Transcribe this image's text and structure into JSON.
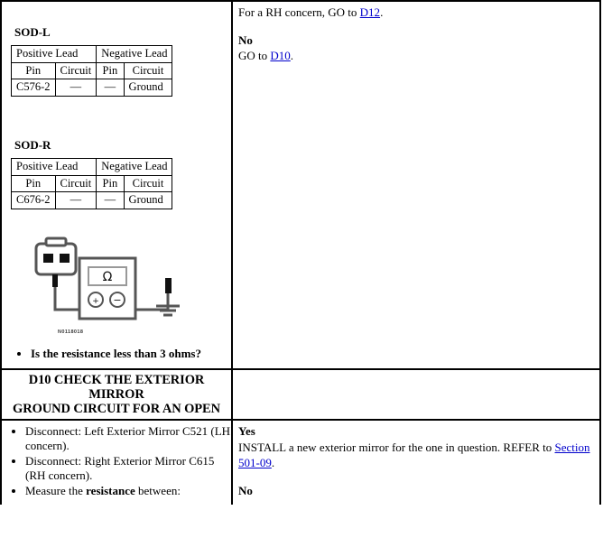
{
  "document": {
    "type": "diagnostic-pinpoint-test",
    "figure_id": "N0118018"
  },
  "row_continued": {
    "left": {
      "tables": [
        {
          "title": "SOD-L",
          "header_row_1": [
            "Positive Lead",
            "Negative Lead"
          ],
          "header_row_2": [
            "Pin",
            "Circuit",
            "Pin",
            "Circuit"
          ],
          "data_row": [
            "C576-2",
            "—",
            "—",
            "Ground"
          ]
        },
        {
          "title": "SOD-R",
          "header_row_1": [
            "Positive Lead",
            "Negative Lead"
          ],
          "header_row_2": [
            "Pin",
            "Circuit",
            "Pin",
            "Circuit"
          ],
          "data_row": [
            "C676-2",
            "—",
            "—",
            "Ground"
          ]
        }
      ],
      "figure_caption": "N0118018",
      "question": "Is the resistance less than 3 ohms?"
    },
    "right": {
      "line_1_pre": "For a RH concern, GO to ",
      "line_1_link": "D12",
      "line_1_post": ".",
      "answer_no_label": "No",
      "answer_no_pre": "GO to ",
      "answer_no_link": "D10",
      "answer_no_post": "."
    }
  },
  "step_d10": {
    "header_line_1": "D10 CHECK THE EXTERIOR MIRROR",
    "header_line_2": "GROUND CIRCUIT FOR AN OPEN",
    "left_bullets": [
      "Disconnect: Left Exterior Mirror C521 (LH concern).",
      "Disconnect: Right Exterior Mirror C615 (RH concern).",
      "Measure the resistance between:"
    ],
    "bullet_3_prefix": "Measure the ",
    "bullet_3_bold": "resistance",
    "bullet_3_suffix": " between:",
    "right": {
      "answer_yes_label": "Yes",
      "answer_yes_pre": "INSTALL a new exterior mirror for the one in question. REFER to ",
      "answer_yes_link": "Section 501-09",
      "answer_yes_post": ".",
      "answer_no_label": "No"
    }
  },
  "colors": {
    "link": "#0000cc",
    "border": "#000000",
    "text": "#000000",
    "figure_line": "#555555"
  }
}
